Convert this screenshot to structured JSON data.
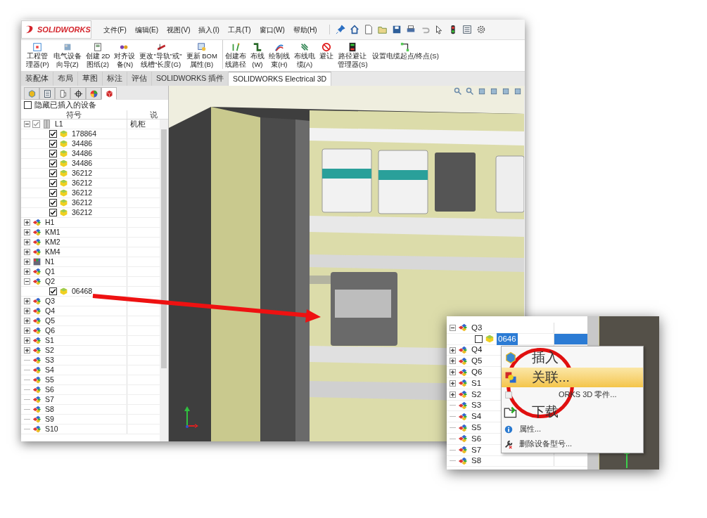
{
  "app": {
    "logo": "SOLIDWORKS"
  },
  "menu": [
    "文件(F)",
    "编辑(E)",
    "视图(V)",
    "插入(I)",
    "工具(T)",
    "窗口(W)",
    "帮助(H)"
  ],
  "ribbon": [
    {
      "lines": [
        "工程管",
        "理器(P)"
      ]
    },
    {
      "lines": [
        "电气设备",
        "向导(Z)"
      ]
    },
    {
      "lines": [
        "创建 2D",
        "图纸(2)"
      ]
    },
    {
      "lines": [
        "对齐设",
        "备(N)"
      ]
    },
    {
      "lines": [
        "更改\"导轨\"或\"",
        "线槽\"长度(G)"
      ]
    },
    {
      "lines": [
        "更新 BOM",
        "属性(B)"
      ]
    },
    {
      "lines": [
        "创建布",
        "线路径"
      ]
    },
    {
      "lines": [
        "布线",
        "(W)"
      ]
    },
    {
      "lines": [
        "绘制线",
        "束(H)"
      ]
    },
    {
      "lines": [
        "布线电",
        "缆(A)"
      ]
    },
    {
      "lines": [
        "避让"
      ]
    },
    {
      "lines": [
        "路径避让",
        "管理器(S)"
      ]
    },
    {
      "lines": [
        "设置电缆起点/终点(S)"
      ]
    }
  ],
  "tabs": [
    {
      "label": "装配体",
      "selected": false
    },
    {
      "label": "布局",
      "selected": false
    },
    {
      "label": "草图",
      "selected": false
    },
    {
      "label": "标注",
      "selected": false
    },
    {
      "label": "评估",
      "selected": false
    },
    {
      "label": "SOLIDWORKS 插件",
      "selected": false
    },
    {
      "label": "SOLIDWORKS Electrical 3D",
      "selected": true
    }
  ],
  "panel_tabs": [
    {
      "selected": false
    },
    {
      "selected": false
    },
    {
      "selected": false
    },
    {
      "selected": false
    },
    {
      "selected": false
    },
    {
      "selected": true
    }
  ],
  "hide_inserted": {
    "label": "隐藏已插入的设备",
    "checked": false
  },
  "columns": [
    "符号",
    "说"
  ],
  "tree": [
    {
      "kind": "cabinet",
      "label": "L1",
      "column_2": "机柜",
      "checked": true,
      "expanded": true,
      "children": [
        {
          "kind": "part",
          "label": "178864",
          "checked": true
        },
        {
          "kind": "part",
          "label": "34486",
          "checked": true
        },
        {
          "kind": "part",
          "label": "34486",
          "checked": true
        },
        {
          "kind": "part",
          "label": "34486",
          "checked": true
        },
        {
          "kind": "part",
          "label": "36212",
          "checked": true
        },
        {
          "kind": "part",
          "label": "36212",
          "checked": true
        },
        {
          "kind": "part",
          "label": "36212",
          "checked": true
        },
        {
          "kind": "part",
          "label": "36212",
          "checked": true
        },
        {
          "kind": "part",
          "label": "36212",
          "checked": true
        }
      ]
    },
    {
      "kind": "device",
      "label": "H1",
      "expanded": false
    },
    {
      "kind": "device",
      "label": "KM1",
      "expanded": false
    },
    {
      "kind": "device",
      "label": "KM2",
      "expanded": false
    },
    {
      "kind": "device",
      "label": "KM4",
      "expanded": false
    },
    {
      "kind": "plc",
      "label": "N1",
      "expanded": false
    },
    {
      "kind": "device",
      "label": "Q1",
      "expanded": false
    },
    {
      "kind": "device",
      "label": "Q2",
      "expanded": true,
      "children": [
        {
          "kind": "part",
          "label": "06468",
          "checked": true
        }
      ]
    },
    {
      "kind": "device",
      "label": "Q3",
      "expanded": false
    },
    {
      "kind": "device",
      "label": "Q4",
      "expanded": false
    },
    {
      "kind": "device",
      "label": "Q5",
      "expanded": false
    },
    {
      "kind": "device",
      "label": "Q6",
      "expanded": false
    },
    {
      "kind": "device",
      "label": "S1",
      "expanded": false
    },
    {
      "kind": "device",
      "label": "S2",
      "expanded": false
    },
    {
      "kind": "symbol",
      "label": "S3"
    },
    {
      "kind": "symbol",
      "label": "S4"
    },
    {
      "kind": "symbol",
      "label": "S5"
    },
    {
      "kind": "symbol",
      "label": "S6"
    },
    {
      "kind": "symbol",
      "label": "S7"
    },
    {
      "kind": "symbol",
      "label": "S8"
    },
    {
      "kind": "symbol",
      "label": "S9"
    },
    {
      "kind": "symbol",
      "label": "S10"
    }
  ],
  "viewport": {
    "kind": "model"
  },
  "inset": {
    "tree": [
      {
        "kind": "device",
        "label": "Q3",
        "expanded": true,
        "children": [
          {
            "kind": "part",
            "label": "0646",
            "checked": false,
            "selected": true
          }
        ]
      },
      {
        "kind": "device",
        "label": "Q4",
        "expanded": false
      },
      {
        "kind": "device",
        "label": "Q5",
        "expanded": false
      },
      {
        "kind": "device",
        "label": "Q6",
        "expanded": false
      },
      {
        "kind": "device",
        "label": "S1",
        "expanded": false
      },
      {
        "kind": "device",
        "label": "S2",
        "expanded": false
      },
      {
        "kind": "symbol",
        "label": "S3"
      },
      {
        "kind": "symbol",
        "label": "S4"
      },
      {
        "kind": "symbol",
        "label": "S5"
      },
      {
        "kind": "symbol",
        "label": "S6"
      },
      {
        "kind": "symbol",
        "label": "S7"
      },
      {
        "kind": "symbol",
        "label": "S8"
      }
    ],
    "context_menu": [
      {
        "label": "插入",
        "kind": "magnified",
        "selected": false
      },
      {
        "label": "关联...",
        "kind": "magnified",
        "selected": true
      },
      {
        "label": "ORKS 3D 零件...",
        "kind": "partial",
        "selected": false
      },
      {
        "label": "下载",
        "kind": "magnified",
        "selected": false
      },
      {
        "label": "属性...",
        "kind": "normal",
        "selected": false
      },
      {
        "label": "删除设备型号...",
        "kind": "normal",
        "selected": false
      }
    ]
  }
}
